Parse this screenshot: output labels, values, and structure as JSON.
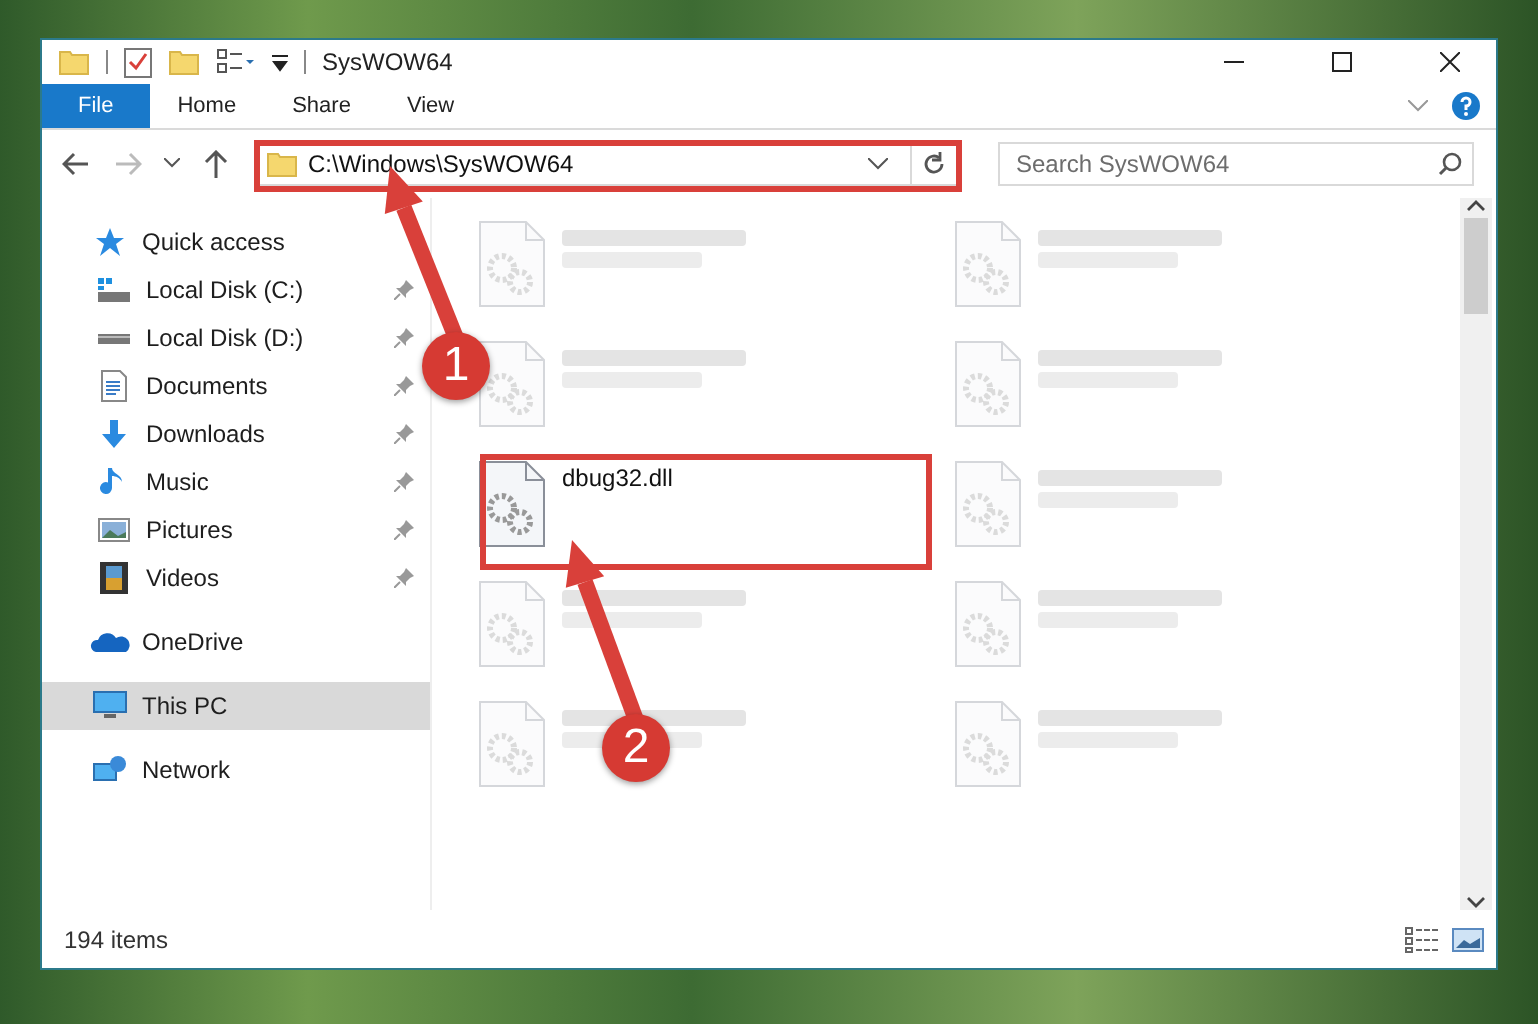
{
  "window": {
    "title": "SysWOW64"
  },
  "ribbon_tabs": [
    {
      "label": "File",
      "selected": true
    },
    {
      "label": "Home",
      "selected": false
    },
    {
      "label": "Share",
      "selected": false
    },
    {
      "label": "View",
      "selected": false
    }
  ],
  "address_bar": {
    "path": "C:\\Windows\\SysWOW64"
  },
  "search": {
    "placeholder": "Search SysWOW64"
  },
  "sidebar": {
    "items": [
      {
        "label": "Quick access",
        "selected": false,
        "children": [
          {
            "label": "Local Disk (C:)",
            "pinned": true
          },
          {
            "label": "Local Disk (D:)",
            "pinned": true
          },
          {
            "label": "Documents",
            "pinned": true
          },
          {
            "label": "Downloads",
            "pinned": true
          },
          {
            "label": "Music",
            "pinned": true
          },
          {
            "label": "Pictures",
            "pinned": true
          },
          {
            "label": "Videos",
            "pinned": true
          }
        ]
      },
      {
        "label": "OneDrive",
        "selected": false
      },
      {
        "label": "This PC",
        "selected": true
      },
      {
        "label": "Network",
        "selected": false
      }
    ]
  },
  "files": [
    {
      "blurred": true
    },
    {
      "blurred": true
    },
    {
      "blurred": true
    },
    {
      "blurred": true
    },
    {
      "name": "dbug32.dll",
      "blurred": false
    },
    {
      "blurred": true
    },
    {
      "blurred": true
    },
    {
      "blurred": true
    },
    {
      "blurred": true
    },
    {
      "blurred": true
    }
  ],
  "status_bar": {
    "item_count": "194 items"
  },
  "callouts": [
    {
      "number": "1"
    },
    {
      "number": "2"
    }
  ]
}
